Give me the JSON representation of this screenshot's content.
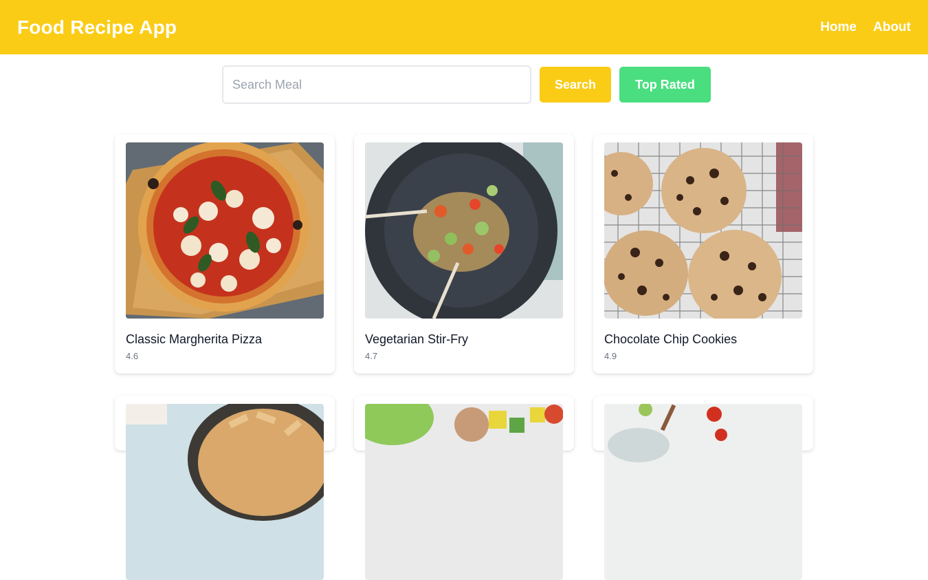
{
  "header": {
    "app_title": "Food Recipe App",
    "nav": [
      {
        "label": "Home"
      },
      {
        "label": "About"
      }
    ]
  },
  "search": {
    "placeholder": "Search Meal",
    "value": "",
    "search_label": "Search",
    "top_rated_label": "Top Rated"
  },
  "colors": {
    "brand": "#facc15",
    "accent_green": "#4ade80"
  },
  "recipes": [
    {
      "title": "Classic Margherita Pizza",
      "rating": "4.6",
      "image": "pizza-photo"
    },
    {
      "title": "Vegetarian Stir-Fry",
      "rating": "4.7",
      "image": "stir-fry-photo"
    },
    {
      "title": "Chocolate Chip Cookies",
      "rating": "4.9",
      "image": "cookies-photo"
    },
    {
      "title": "",
      "rating": "",
      "image": "pasta-photo"
    },
    {
      "title": "",
      "rating": "",
      "image": "salad-photo"
    },
    {
      "title": "",
      "rating": "",
      "image": "sauce-photo"
    }
  ]
}
